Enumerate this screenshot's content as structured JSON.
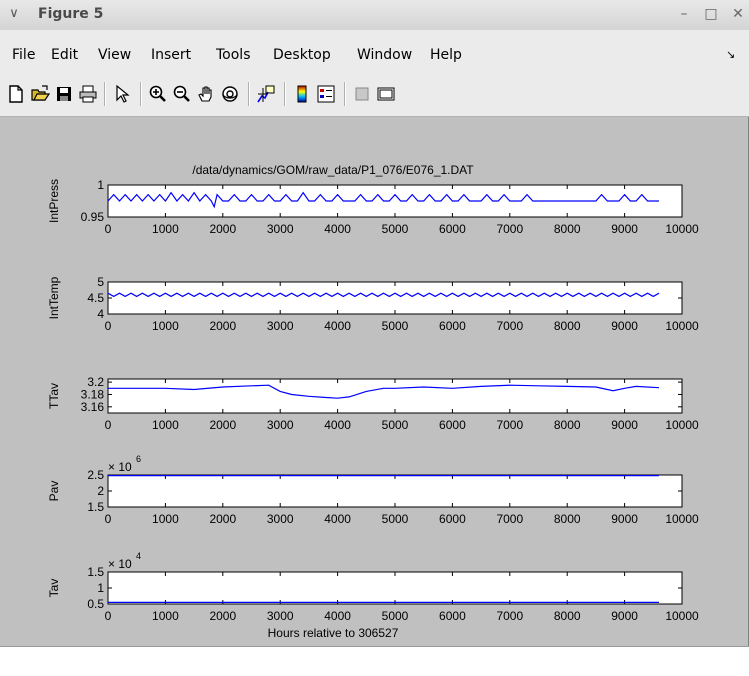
{
  "window": {
    "title": "Figure 5",
    "menu_glyph": "∨",
    "minimize_glyph": "–",
    "maximize_glyph": "□",
    "close_glyph": "✕",
    "menu_arrow": "↘"
  },
  "menu": {
    "items": [
      {
        "label": "File"
      },
      {
        "label": "Edit"
      },
      {
        "label": "View"
      },
      {
        "label": "Insert"
      },
      {
        "label": "Tools"
      },
      {
        "label": "Desktop"
      },
      {
        "label": "Window"
      },
      {
        "label": "Help"
      }
    ]
  },
  "toolbar": {
    "icons": [
      "new-figure-icon",
      "open-file-icon",
      "save-icon",
      "print-icon",
      "select-arrow-icon",
      "zoom-in-icon",
      "zoom-out-icon",
      "pan-hand-icon",
      "rotate-3d-icon",
      "data-cursor-icon",
      "colorbar-icon",
      "legend-icon",
      "hide-plot-tools-icon",
      "show-plot-tools-icon"
    ]
  },
  "figure": {
    "title": "/data/dynamics/GOM/raw_data/P1_076/E076_1.DAT",
    "xlabel": "Hours relative to 306527",
    "xticks": [
      "0",
      "1000",
      "2000",
      "3000",
      "4000",
      "5000",
      "6000",
      "7000",
      "8000",
      "9000",
      "10000"
    ]
  },
  "chart_data": [
    {
      "type": "line",
      "ylabel": "IntPress",
      "ytick_labels": [
        "0.95",
        "1"
      ],
      "ylim": [
        0.95,
        1.0
      ],
      "xlim": [
        0,
        10000
      ],
      "series": [
        {
          "x": [
            0,
            100,
            200,
            300,
            400,
            500,
            600,
            700,
            800,
            900,
            1000,
            1100,
            1200,
            1300,
            1400,
            1500,
            1600,
            1700,
            1800,
            1850,
            1900,
            2000,
            2100,
            2200,
            2300,
            2400,
            2500,
            2600,
            2700,
            2800,
            2900,
            3000,
            3100,
            3200,
            3300,
            3400,
            3500,
            3600,
            3700,
            3800,
            3900,
            4000,
            4100,
            4200,
            4300,
            4400,
            4500,
            4600,
            4700,
            4800,
            4900,
            5000,
            5100,
            5200,
            5300,
            5400,
            5500,
            5600,
            5700,
            5800,
            5900,
            6000,
            6100,
            6200,
            6300,
            6400,
            6500,
            6600,
            6700,
            6800,
            6900,
            7000,
            7100,
            7200,
            7300,
            7400,
            7500,
            7600,
            7700,
            7800,
            7900,
            8000,
            8100,
            8200,
            8300,
            8400,
            8500,
            8600,
            8700,
            8800,
            8900,
            9000,
            9100,
            9200,
            9300,
            9400,
            9500,
            9600
          ],
          "y": [
            0.975,
            0.985,
            0.975,
            0.985,
            0.975,
            0.985,
            0.975,
            0.985,
            0.975,
            0.985,
            0.975,
            0.988,
            0.975,
            0.985,
            0.975,
            0.988,
            0.975,
            0.985,
            0.975,
            0.966,
            0.985,
            0.975,
            0.975,
            0.985,
            0.975,
            0.975,
            0.985,
            0.975,
            0.975,
            0.985,
            0.975,
            0.975,
            0.985,
            0.975,
            0.975,
            0.988,
            0.975,
            0.975,
            0.985,
            0.975,
            0.975,
            0.985,
            0.975,
            0.975,
            0.975,
            0.985,
            0.975,
            0.975,
            0.985,
            0.975,
            0.975,
            0.985,
            0.975,
            0.975,
            0.985,
            0.975,
            0.975,
            0.985,
            0.975,
            0.975,
            0.985,
            0.975,
            0.975,
            0.985,
            0.975,
            0.975,
            0.975,
            0.985,
            0.975,
            0.975,
            0.985,
            0.975,
            0.975,
            0.975,
            0.985,
            0.975,
            0.975,
            0.975,
            0.975,
            0.975,
            0.975,
            0.975,
            0.975,
            0.975,
            0.975,
            0.975,
            0.975,
            0.985,
            0.975,
            0.975,
            0.975,
            0.985,
            0.975,
            0.975,
            0.985,
            0.975,
            0.975,
            0.975
          ],
          "color": "#0000ff"
        }
      ]
    },
    {
      "type": "line",
      "ylabel": "IntTemp",
      "ytick_labels": [
        "4",
        "4.5",
        "5"
      ],
      "ylim": [
        4,
        5
      ],
      "xlim": [
        0,
        10000
      ],
      "series": [
        {
          "x": [
            0,
            100,
            200,
            300,
            400,
            500,
            600,
            700,
            800,
            900,
            1000,
            1100,
            1200,
            1300,
            1400,
            1500,
            1600,
            1700,
            1800,
            1900,
            2000,
            2100,
            2200,
            2300,
            2400,
            2500,
            2600,
            2700,
            2800,
            2900,
            3000,
            3100,
            3200,
            3300,
            3400,
            3500,
            3600,
            3700,
            3800,
            3900,
            4000,
            4100,
            4200,
            4300,
            4400,
            4500,
            4600,
            4700,
            4800,
            4900,
            5000,
            5100,
            5200,
            5300,
            5400,
            5500,
            5600,
            5700,
            5800,
            5900,
            6000,
            6100,
            6200,
            6300,
            6400,
            6500,
            6600,
            6700,
            6800,
            6900,
            7000,
            7100,
            7200,
            7300,
            7400,
            7500,
            7600,
            7700,
            7800,
            7900,
            8000,
            8100,
            8200,
            8300,
            8400,
            8500,
            8600,
            8700,
            8800,
            8900,
            9000,
            9100,
            9200,
            9300,
            9400,
            9500,
            9600
          ],
          "y": [
            4.65,
            4.55,
            4.65,
            4.55,
            4.65,
            4.55,
            4.65,
            4.55,
            4.65,
            4.55,
            4.65,
            4.55,
            4.65,
            4.55,
            4.65,
            4.55,
            4.65,
            4.55,
            4.65,
            4.55,
            4.65,
            4.55,
            4.65,
            4.55,
            4.65,
            4.55,
            4.65,
            4.55,
            4.65,
            4.55,
            4.65,
            4.55,
            4.65,
            4.55,
            4.65,
            4.55,
            4.65,
            4.55,
            4.65,
            4.55,
            4.65,
            4.55,
            4.65,
            4.55,
            4.65,
            4.55,
            4.65,
            4.55,
            4.65,
            4.55,
            4.65,
            4.55,
            4.65,
            4.55,
            4.65,
            4.55,
            4.65,
            4.55,
            4.65,
            4.55,
            4.65,
            4.55,
            4.65,
            4.55,
            4.65,
            4.55,
            4.65,
            4.55,
            4.65,
            4.55,
            4.65,
            4.55,
            4.65,
            4.55,
            4.65,
            4.55,
            4.65,
            4.55,
            4.65,
            4.55,
            4.65,
            4.55,
            4.65,
            4.55,
            4.65,
            4.55,
            4.65,
            4.55,
            4.65,
            4.55,
            4.65,
            4.55,
            4.65,
            4.55,
            4.65,
            4.55,
            4.65
          ],
          "color": "#0000ff"
        }
      ]
    },
    {
      "type": "line",
      "ylabel": "TTav",
      "ytick_labels": [
        "3.16",
        "3.18",
        "3.2"
      ],
      "ylim": [
        3.15,
        3.205
      ],
      "xlim": [
        0,
        10000
      ],
      "series": [
        {
          "x": [
            0,
            500,
            1000,
            1500,
            2000,
            2500,
            2800,
            3000,
            3200,
            3500,
            3800,
            4000,
            4200,
            4500,
            4800,
            5000,
            5500,
            6000,
            6500,
            7000,
            7500,
            8000,
            8500,
            8800,
            9000,
            9200,
            9600
          ],
          "y": [
            3.19,
            3.19,
            3.19,
            3.188,
            3.192,
            3.194,
            3.195,
            3.185,
            3.18,
            3.177,
            3.175,
            3.174,
            3.176,
            3.185,
            3.19,
            3.19,
            3.192,
            3.19,
            3.193,
            3.195,
            3.194,
            3.193,
            3.192,
            3.186,
            3.19,
            3.193,
            3.191
          ],
          "color": "#0000ff"
        }
      ]
    },
    {
      "type": "line",
      "ylabel": "Pav",
      "exponent_label": "× 10",
      "exponent": "6",
      "ytick_labels": [
        "1.5",
        "2",
        "2.5"
      ],
      "ylim": [
        1.5,
        2.5
      ],
      "xlim": [
        0,
        10000
      ],
      "series": [
        {
          "x": [
            0,
            9600
          ],
          "y": [
            2.48,
            2.48
          ],
          "color": "#0000ff"
        }
      ]
    },
    {
      "type": "line",
      "ylabel": "Tav",
      "exponent_label": "× 10",
      "exponent": "4",
      "ytick_labels": [
        "0.5",
        "1",
        "1.5"
      ],
      "ylim": [
        0.5,
        1.5
      ],
      "xlim": [
        0,
        10000
      ],
      "series": [
        {
          "x": [
            0,
            9600
          ],
          "y": [
            0.55,
            0.55
          ],
          "color": "#0000ff"
        }
      ]
    }
  ]
}
